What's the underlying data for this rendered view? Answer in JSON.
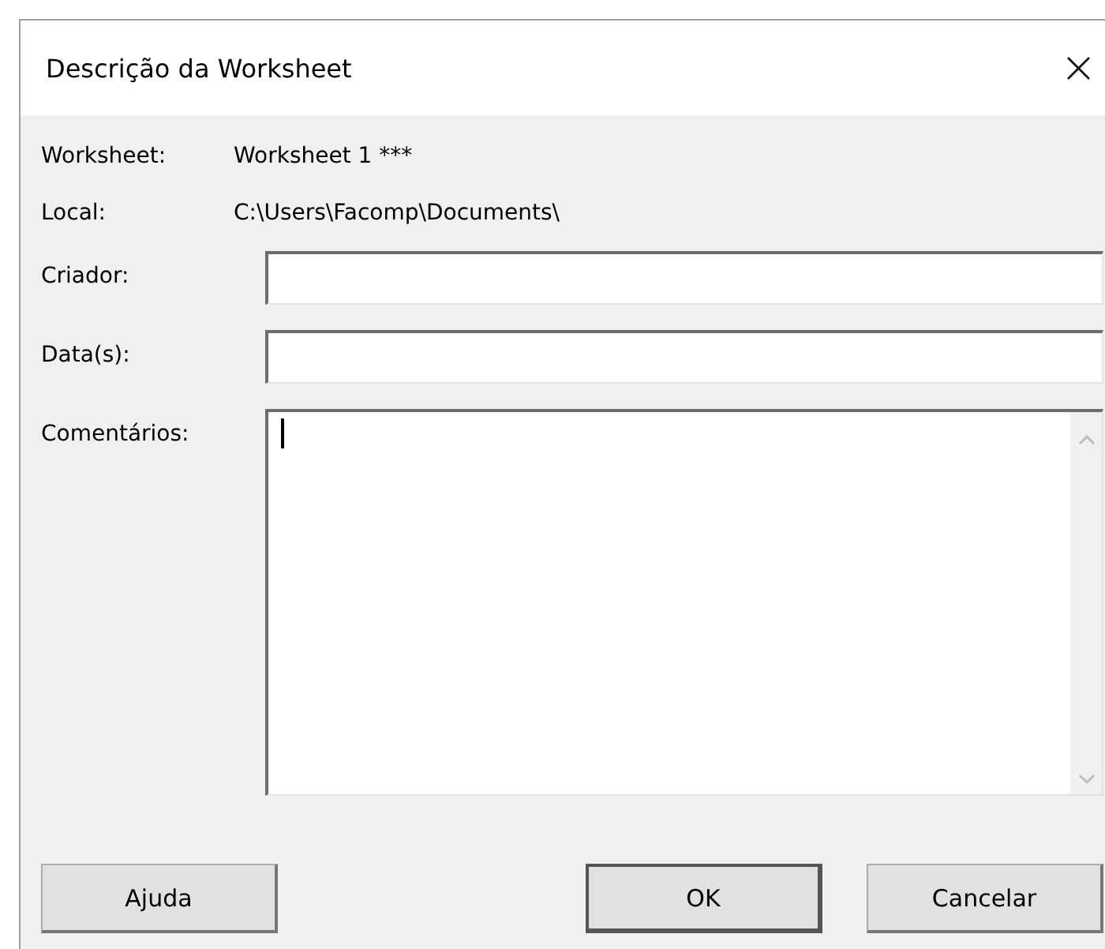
{
  "window": {
    "title": "Descrição da Worksheet",
    "close": "×"
  },
  "info": [
    {
      "label": "Worksheet:",
      "value": "Worksheet 1 ***"
    },
    {
      "label": "Local:",
      "value": "C:\\Users\\Facomp\\Documents\\"
    }
  ],
  "fields": [
    {
      "label": "Criador:",
      "kind": "line",
      "focused": false
    },
    {
      "label": "Data(s):",
      "kind": "line",
      "focused": false
    },
    {
      "label": "Comentários:",
      "kind": "memo",
      "focused": true
    }
  ],
  "buttons": [
    {
      "label": "Ajuda",
      "default": false
    },
    {
      "label": "OK",
      "default": true
    },
    {
      "label": "Cancelar",
      "default": false
    }
  ]
}
